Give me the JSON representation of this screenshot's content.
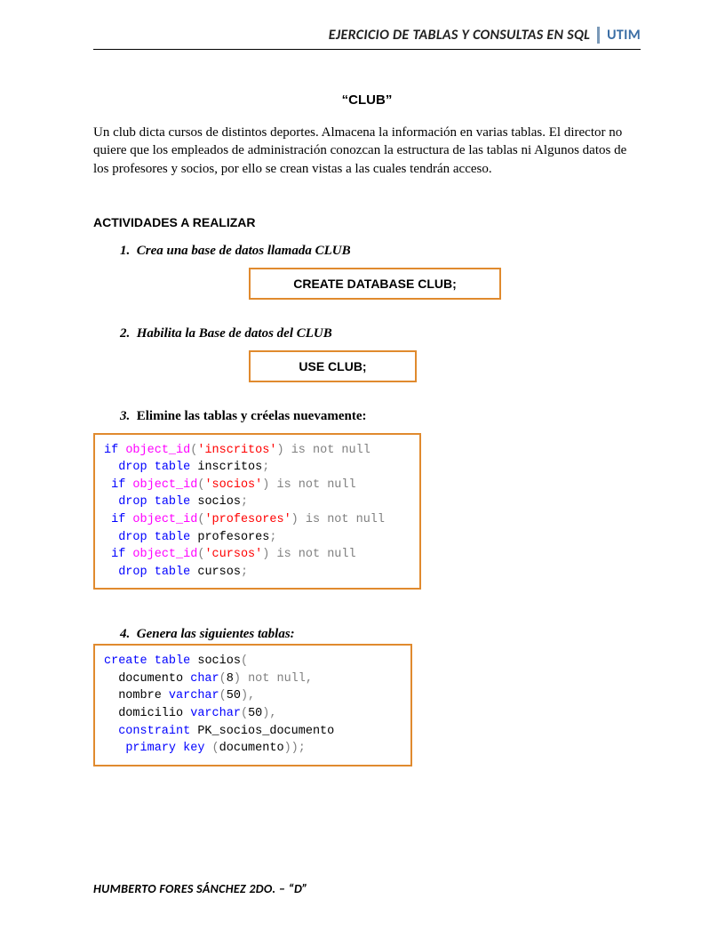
{
  "header": {
    "left": "EJERCICIO DE TABLAS Y CONSULTAS EN SQL",
    "right": "UTIM"
  },
  "title": "“CLUB”",
  "intro": "Un club dicta cursos de distintos deportes. Almacena la información en varias tablas. El director no quiere que los empleados de administración conozcan la estructura de las tablas ni Algunos datos de los profesores y socios, por ello se crean vistas a las cuales tendrán acceso.",
  "activities_heading": "ACTIVIDADES A REALIZAR",
  "steps": {
    "s1": {
      "num": "1.",
      "title": "Crea una base de datos llamada CLUB",
      "cmd": "CREATE DATABASE CLUB;"
    },
    "s2": {
      "num": "2.",
      "title": "Habilita la Base de datos del CLUB",
      "cmd": "USE CLUB;"
    },
    "s3": {
      "num": "3.",
      "title": "Elimine las tablas y créelas nuevamente:",
      "code": {
        "if": "if",
        "object_id": "object_id",
        "tbl1": "'inscritos'",
        "tbl2": "'socios'",
        "tbl3": "'profesores'",
        "tbl4": "'cursos'",
        "isnotnull": "is not null",
        "drop": "drop",
        "table": "table",
        "n1": "inscritos",
        "n2": "socios",
        "n3": "profesores",
        "n4": "cursos"
      }
    },
    "s4": {
      "num": "4.",
      "title": "Genera las siguientes tablas:",
      "code": {
        "create": "create",
        "table": "table",
        "socios": "socios",
        "documento": "documento",
        "char": "char",
        "eight": "8",
        "not_null": "not null",
        "nombre": "nombre",
        "varchar": "varchar",
        "fifty": "50",
        "domicilio": "domicilio",
        "constraint": "constraint",
        "pk": "PK_socios_documento",
        "primary_key": "primary key",
        "doc2": "documento"
      }
    }
  },
  "footer": "HUMBERTO FORES SÁNCHEZ 2DO. – “D”"
}
